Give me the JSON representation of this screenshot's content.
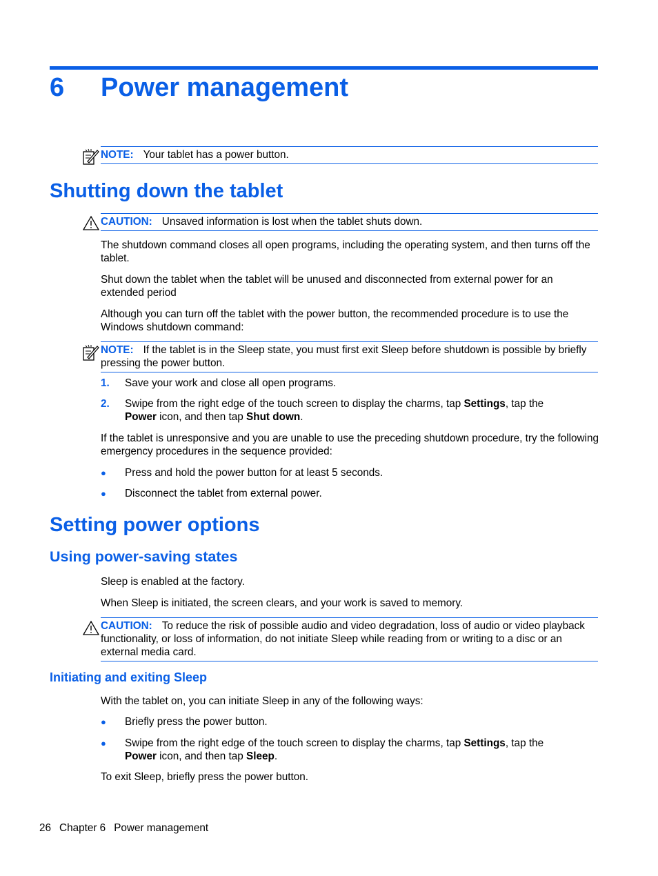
{
  "chapter": {
    "number": "6",
    "title": "Power management"
  },
  "note_intro": {
    "label": "NOTE:",
    "text": "Your tablet has a power button.",
    "icon": "note-icon"
  },
  "section_shutdown": {
    "heading": "Shutting down the tablet",
    "caution": {
      "label": "CAUTION:",
      "text": "Unsaved information is lost when the tablet shuts down.",
      "icon": "caution-triangle-icon"
    },
    "paragraphs": [
      "The shutdown command closes all open programs, including the operating system, and then turns off the tablet.",
      "Shut down the tablet when the tablet will be unused and disconnected from external power for an extended period",
      "Although you can turn off the tablet with the power button, the recommended procedure is to use the Windows shutdown command:"
    ],
    "note": {
      "label": "NOTE:",
      "text": "If the tablet is in the Sleep state, you must first exit Sleep before shutdown is possible by briefly pressing the power button.",
      "icon": "note-icon"
    },
    "steps": [
      {
        "marker": "1.",
        "text": "Save your work and close all open programs."
      },
      {
        "marker": "2.",
        "parts": [
          "Swipe from the right edge of the touch screen to display the charms, tap ",
          "Settings",
          ", tap the ",
          "Power",
          " icon, and then tap ",
          "Shut down",
          "."
        ]
      }
    ],
    "emergency_intro": "If the tablet is unresponsive and you are unable to use the preceding shutdown procedure, try the following emergency procedures in the sequence provided:",
    "emergency_bullets": [
      "Press and hold the power button for at least 5 seconds.",
      "Disconnect the tablet from external power."
    ]
  },
  "section_power_options": {
    "heading": "Setting power options",
    "subheading": "Using power-saving states",
    "paragraphs": [
      "Sleep is enabled at the factory.",
      "When Sleep is initiated, the screen clears, and your work is saved to memory."
    ],
    "caution": {
      "label": "CAUTION:",
      "text": "To reduce the risk of possible audio and video degradation, loss of audio or video playback functionality, or loss of information, do not initiate Sleep while reading from or writing to a disc or an external media card.",
      "icon": "caution-triangle-icon"
    },
    "sub_subheading": "Initiating and exiting Sleep",
    "sleep_intro": "With the tablet on, you can initiate Sleep in any of the following ways:",
    "sleep_bullets": [
      {
        "text": "Briefly press the power button."
      },
      {
        "parts": [
          "Swipe from the right edge of the touch screen to display the charms, tap ",
          "Settings",
          ", tap the ",
          "Power",
          " icon, and then tap ",
          "Sleep",
          "."
        ]
      }
    ],
    "exit_text": "To exit Sleep, briefly press the power button."
  },
  "footer": {
    "page_number": "26",
    "chapter_label": "Chapter 6",
    "chapter_title": "Power management"
  },
  "colors": {
    "accent": "#0a5fe6",
    "text": "#000000"
  }
}
